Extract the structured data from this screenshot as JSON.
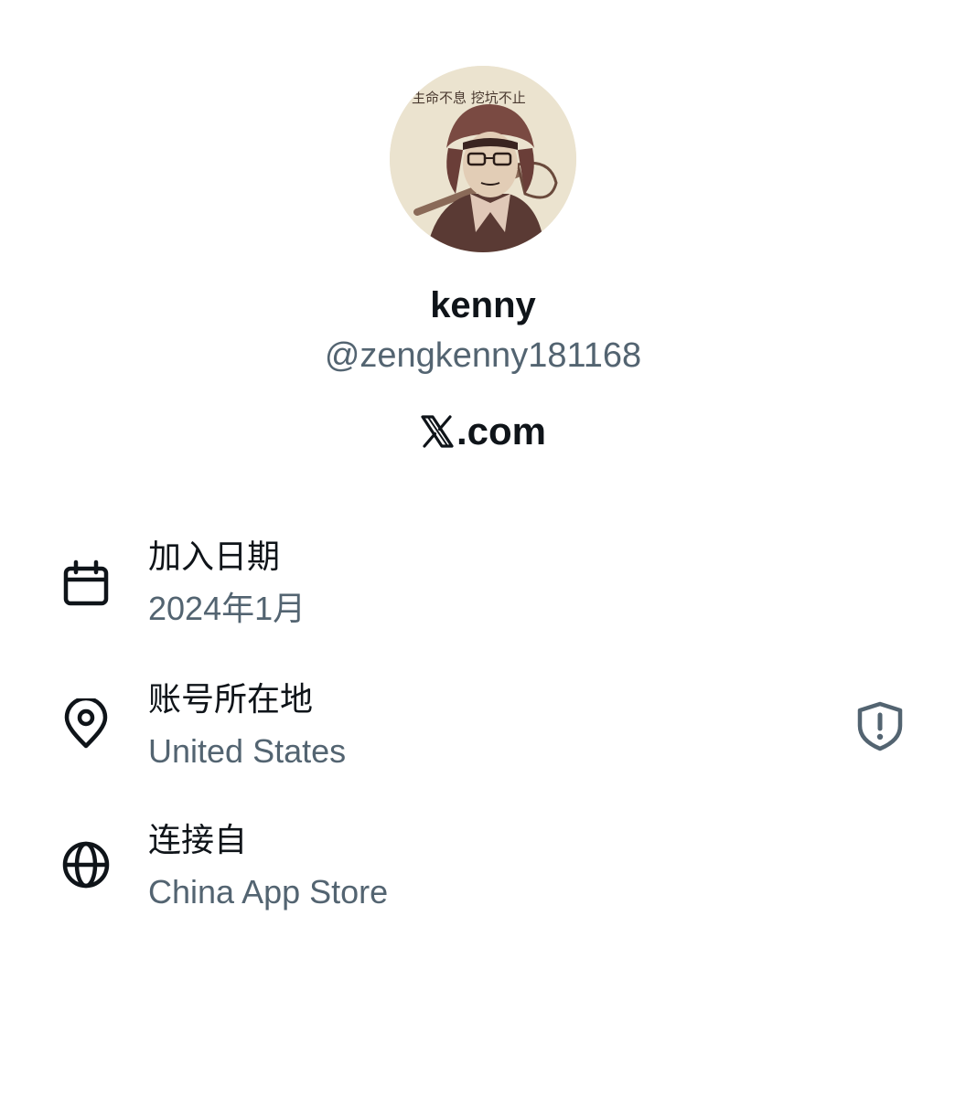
{
  "profile": {
    "avatar_caption": "生命不息 挖坑不止",
    "display_name": "kenny",
    "handle": "@zengkenny181168",
    "site_suffix": ".com",
    "site_icon": "x-logo-icon"
  },
  "details": [
    {
      "icon": "calendar-icon",
      "label": "加入日期",
      "value": "2024年1月"
    },
    {
      "icon": "location-pin-icon",
      "label": "账号所在地",
      "value": "United States",
      "badge": "shield-alert-icon"
    },
    {
      "icon": "globe-icon",
      "label": "连接自",
      "value": "China App Store"
    }
  ],
  "colors": {
    "primary_text": "#0f1419",
    "secondary_text": "#536471",
    "background": "#ffffff"
  }
}
